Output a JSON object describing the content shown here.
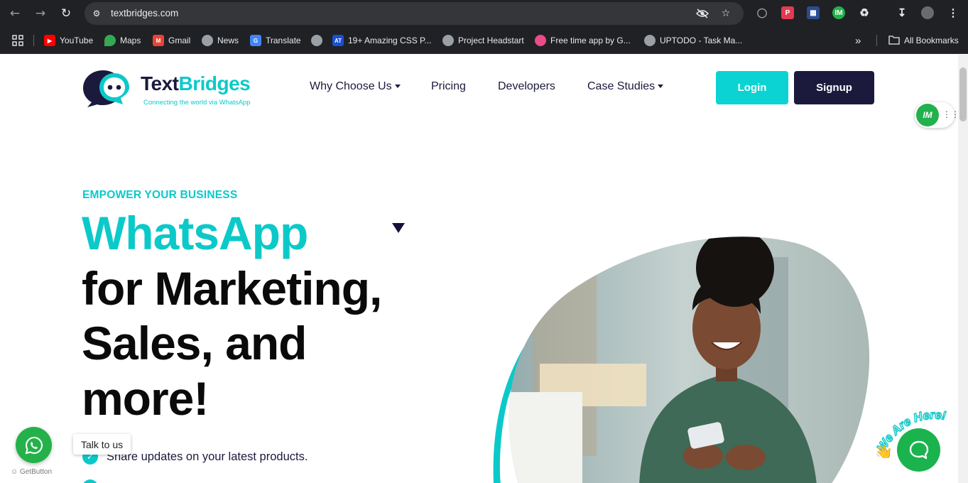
{
  "browser": {
    "url": "textbridges.com",
    "bookmarks": [
      {
        "label": "YouTube",
        "icon": "youtube-icon",
        "color": "#ff0000"
      },
      {
        "label": "Maps",
        "icon": "maps-icon",
        "color": "#34a853"
      },
      {
        "label": "Gmail",
        "icon": "gmail-icon",
        "color": "#ea4335"
      },
      {
        "label": "News",
        "icon": "globe-icon",
        "color": "#9aa0a6"
      },
      {
        "label": "Translate",
        "icon": "translate-icon",
        "color": "#4285f4"
      },
      {
        "label": "",
        "icon": "globe-icon",
        "color": "#9aa0a6"
      },
      {
        "label": "19+ Amazing CSS P...",
        "icon": "at-icon",
        "color": "#1a4fd6"
      },
      {
        "label": "Project Headstart",
        "icon": "globe-icon",
        "color": "#9aa0a6"
      },
      {
        "label": "Free time app by G...",
        "icon": "dribbble-icon",
        "color": "#ea4c89"
      },
      {
        "label": "UPTODO - Task Ma...",
        "icon": "globe-icon",
        "color": "#9aa0a6"
      }
    ],
    "all_bookmarks": "All Bookmarks",
    "more_bookmarks": "»"
  },
  "site": {
    "logo_text_1": "Text",
    "logo_text_2": "Bridges",
    "logo_tagline": "Connecting the world via WhatsApp",
    "nav": {
      "why": "Why Choose Us",
      "pricing": "Pricing",
      "developers": "Developers",
      "case_studies": "Case Studies"
    },
    "login": "Login",
    "signup": "Signup",
    "im_badge": "IM"
  },
  "hero": {
    "eyebrow": "EMPOWER YOUR BUSINESS",
    "accent": "WhatsApp",
    "line2": "for Marketing,",
    "line3": "Sales, and",
    "line4": "more!",
    "bullet1": "Share updates on your latest products."
  },
  "widgets": {
    "talk_to_us": "Talk to us",
    "getbutton": "GetButton",
    "we_are_here": "We Are Here!"
  },
  "colors": {
    "accent": "#0cc9c9",
    "navy": "#1b1a3d",
    "whatsapp": "#25b14a"
  }
}
